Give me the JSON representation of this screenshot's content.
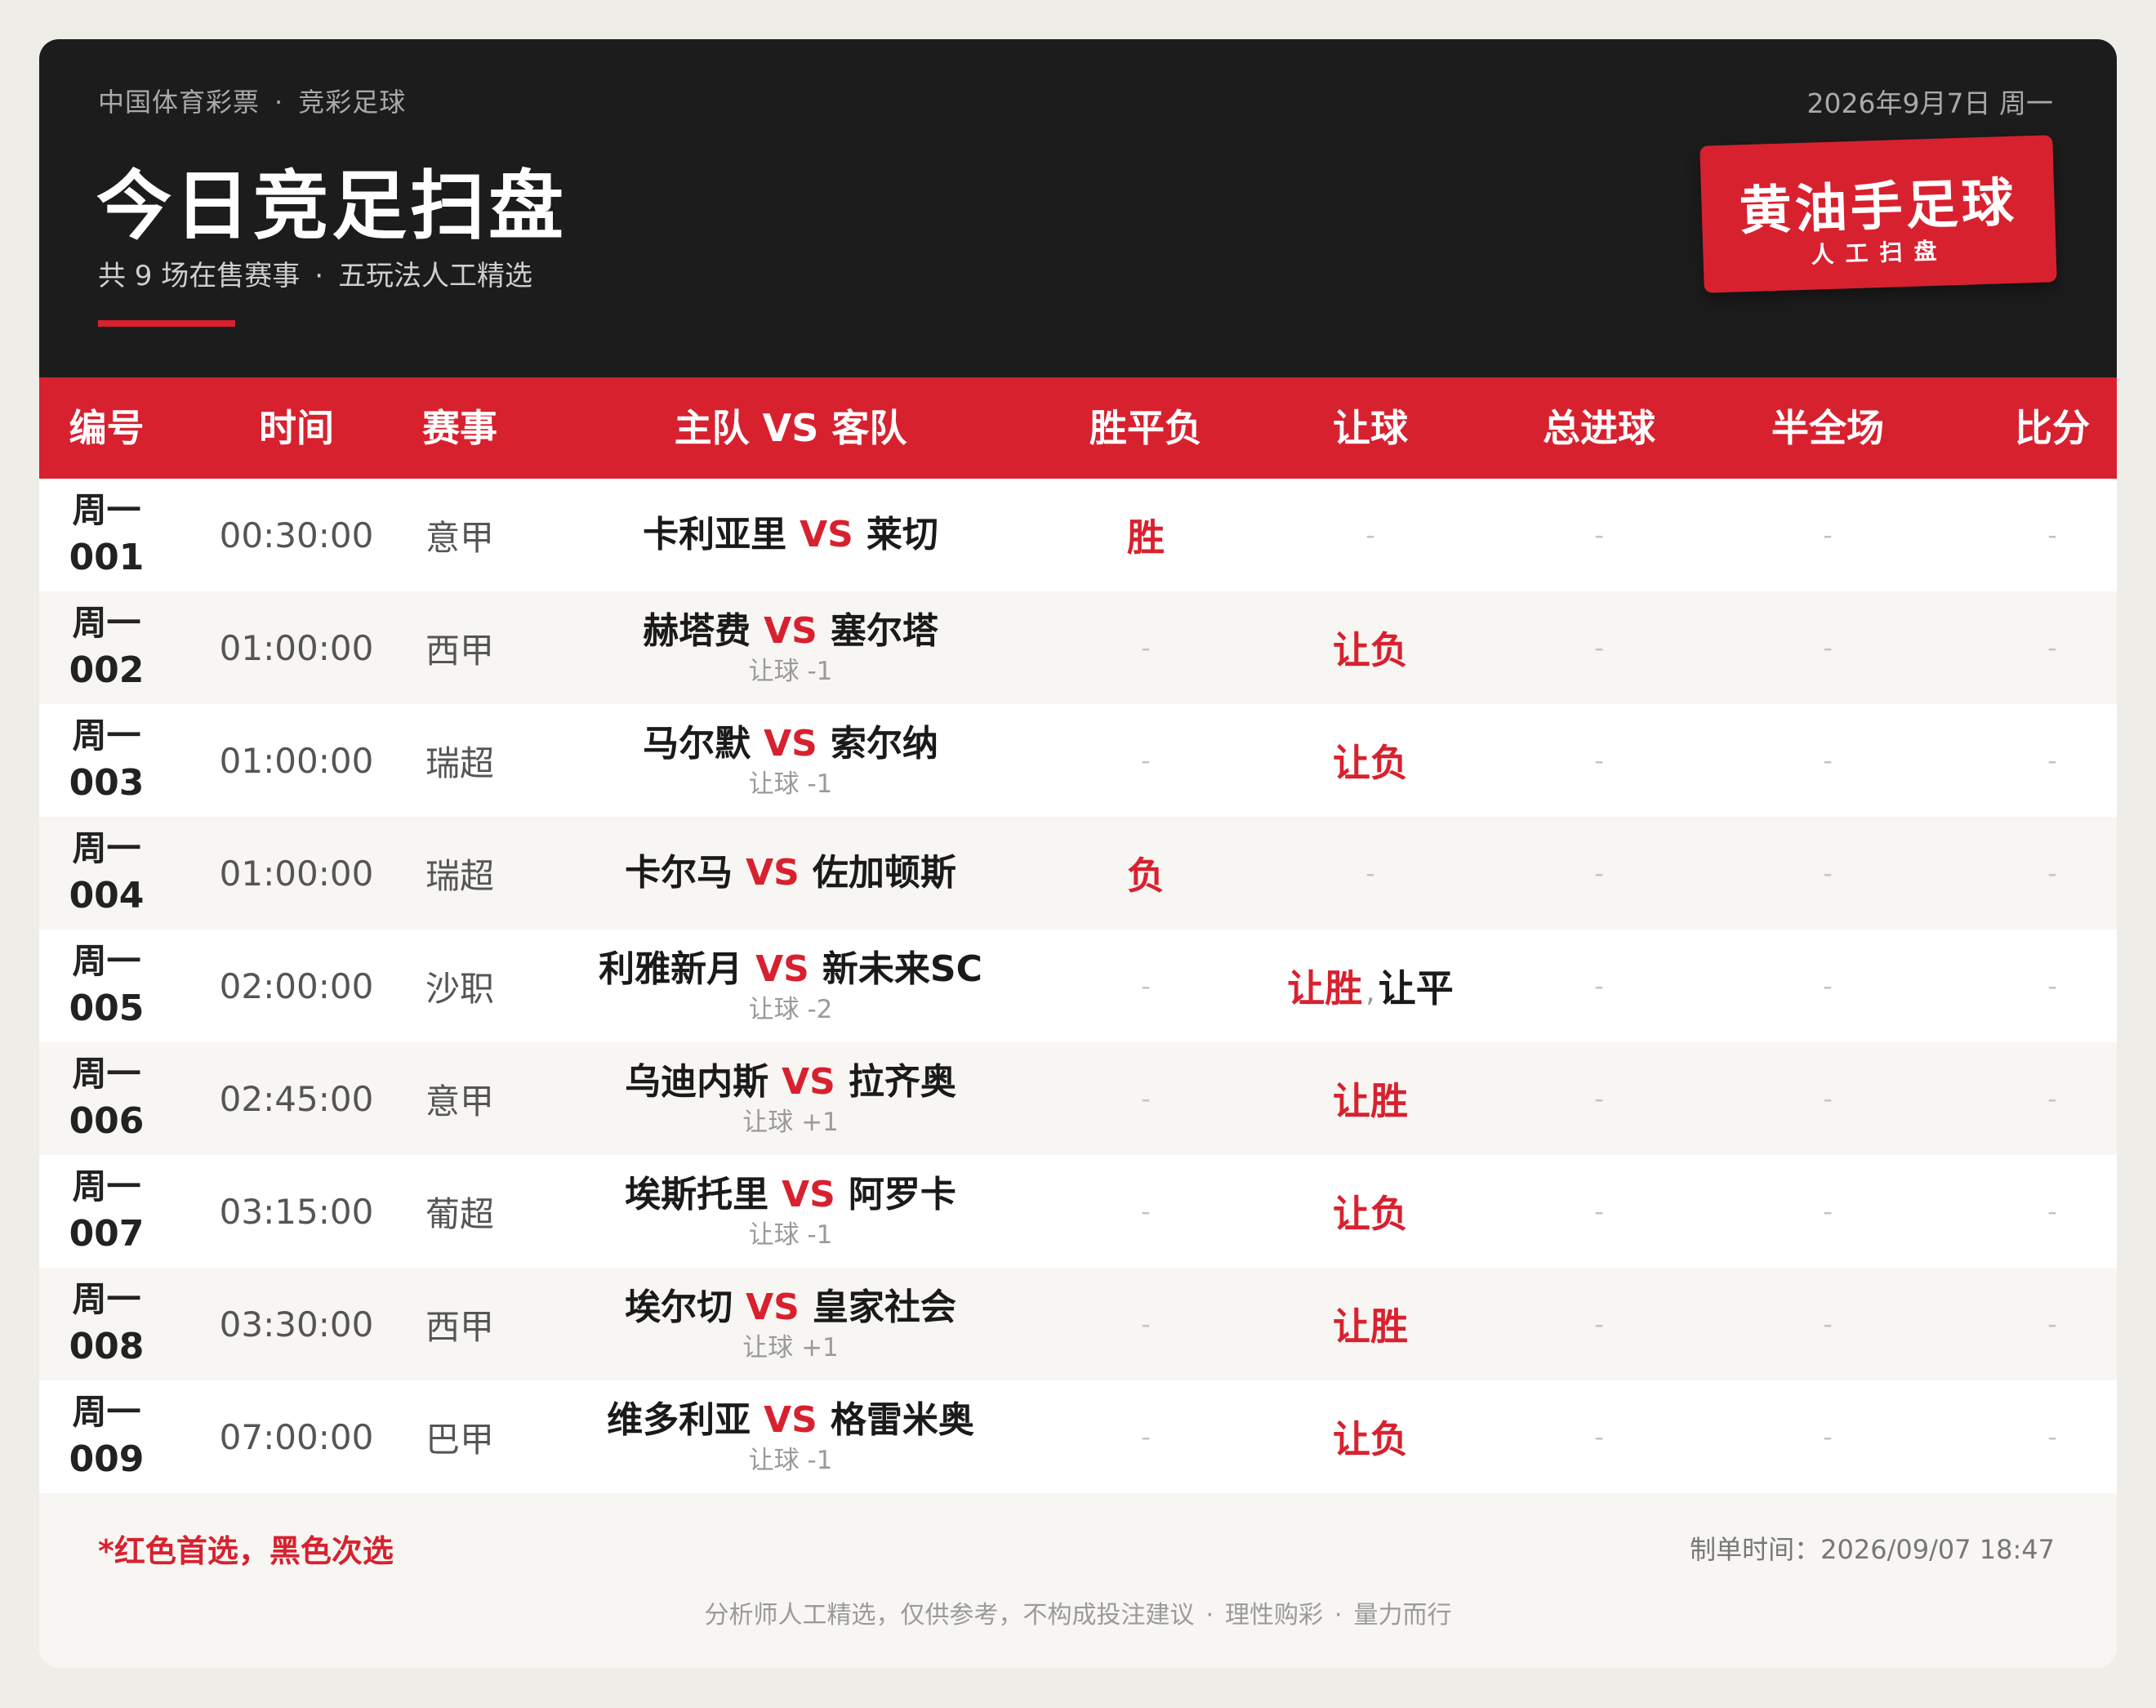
{
  "header": {
    "brand": "中国体育彩票",
    "brand_dot": "·",
    "product": "竞彩足球",
    "date": "2026年9月7日 周一",
    "title": "今日竞足扫盘",
    "subtitle_count": "共 9 场在售赛事",
    "subtitle_dot": "·",
    "subtitle_desc": "五玩法人工精选",
    "logo_name": "黄油手足球",
    "logo_tag": "人工扫盘"
  },
  "colors": {
    "accent": "#d8212f",
    "header_bg": "#1c1c1c",
    "page_bg": "#f7f6f2"
  },
  "table": {
    "columns": [
      "编号",
      "时间",
      "赛事",
      "主队 VS 客队",
      "胜平负",
      "让球",
      "总进球",
      "半全场",
      "比分"
    ],
    "vs": "VS",
    "dash": "-",
    "rows": [
      {
        "weekday": "周一",
        "no": "001",
        "time": "00:30:00",
        "league": "意甲",
        "home": "卡利亚里",
        "away": "莱切",
        "handicap": "",
        "spf": "胜",
        "rq_red": "",
        "rq_sep": "",
        "rq_black": "",
        "zjq": "-",
        "bqc": "-",
        "bf": "-"
      },
      {
        "weekday": "周一",
        "no": "002",
        "time": "01:00:00",
        "league": "西甲",
        "home": "赫塔费",
        "away": "塞尔塔",
        "handicap": "让球 -1",
        "spf": "",
        "rq_red": "让负",
        "rq_sep": "",
        "rq_black": "",
        "zjq": "-",
        "bqc": "-",
        "bf": "-"
      },
      {
        "weekday": "周一",
        "no": "003",
        "time": "01:00:00",
        "league": "瑞超",
        "home": "马尔默",
        "away": "索尔纳",
        "handicap": "让球 -1",
        "spf": "",
        "rq_red": "让负",
        "rq_sep": "",
        "rq_black": "",
        "zjq": "-",
        "bqc": "-",
        "bf": "-"
      },
      {
        "weekday": "周一",
        "no": "004",
        "time": "01:00:00",
        "league": "瑞超",
        "home": "卡尔马",
        "away": "佐加顿斯",
        "handicap": "",
        "spf": "负",
        "rq_red": "",
        "rq_sep": "",
        "rq_black": "",
        "zjq": "-",
        "bqc": "-",
        "bf": "-"
      },
      {
        "weekday": "周一",
        "no": "005",
        "time": "02:00:00",
        "league": "沙职",
        "home": "利雅新月",
        "away": "新未来SC",
        "handicap": "让球 -2",
        "spf": "",
        "rq_red": "让胜",
        "rq_sep": ",",
        "rq_black": "让平",
        "zjq": "-",
        "bqc": "-",
        "bf": "-"
      },
      {
        "weekday": "周一",
        "no": "006",
        "time": "02:45:00",
        "league": "意甲",
        "home": "乌迪内斯",
        "away": "拉齐奥",
        "handicap": "让球 +1",
        "spf": "",
        "rq_red": "让胜",
        "rq_sep": "",
        "rq_black": "",
        "zjq": "-",
        "bqc": "-",
        "bf": "-"
      },
      {
        "weekday": "周一",
        "no": "007",
        "time": "03:15:00",
        "league": "葡超",
        "home": "埃斯托里",
        "away": "阿罗卡",
        "handicap": "让球 -1",
        "spf": "",
        "rq_red": "让负",
        "rq_sep": "",
        "rq_black": "",
        "zjq": "-",
        "bqc": "-",
        "bf": "-"
      },
      {
        "weekday": "周一",
        "no": "008",
        "time": "03:30:00",
        "league": "西甲",
        "home": "埃尔切",
        "away": "皇家社会",
        "handicap": "让球 +1",
        "spf": "",
        "rq_red": "让胜",
        "rq_sep": "",
        "rq_black": "",
        "zjq": "-",
        "bqc": "-",
        "bf": "-"
      },
      {
        "weekday": "周一",
        "no": "009",
        "time": "07:00:00",
        "league": "巴甲",
        "home": "维多利亚",
        "away": "格雷米奥",
        "handicap": "让球 -1",
        "spf": "",
        "rq_red": "让负",
        "rq_sep": "",
        "rq_black": "",
        "zjq": "-",
        "bqc": "-",
        "bf": "-"
      }
    ]
  },
  "footer": {
    "note": "*红色首选，黑色次选",
    "made_time": "制单时间：2026/09/07 18:47",
    "disclaimer_1": "分析师人工精选，仅供参考，不构成投注建议",
    "disclaimer_dot": "·",
    "disclaimer_2": "理性购彩",
    "disclaimer_3": "量力而行"
  }
}
